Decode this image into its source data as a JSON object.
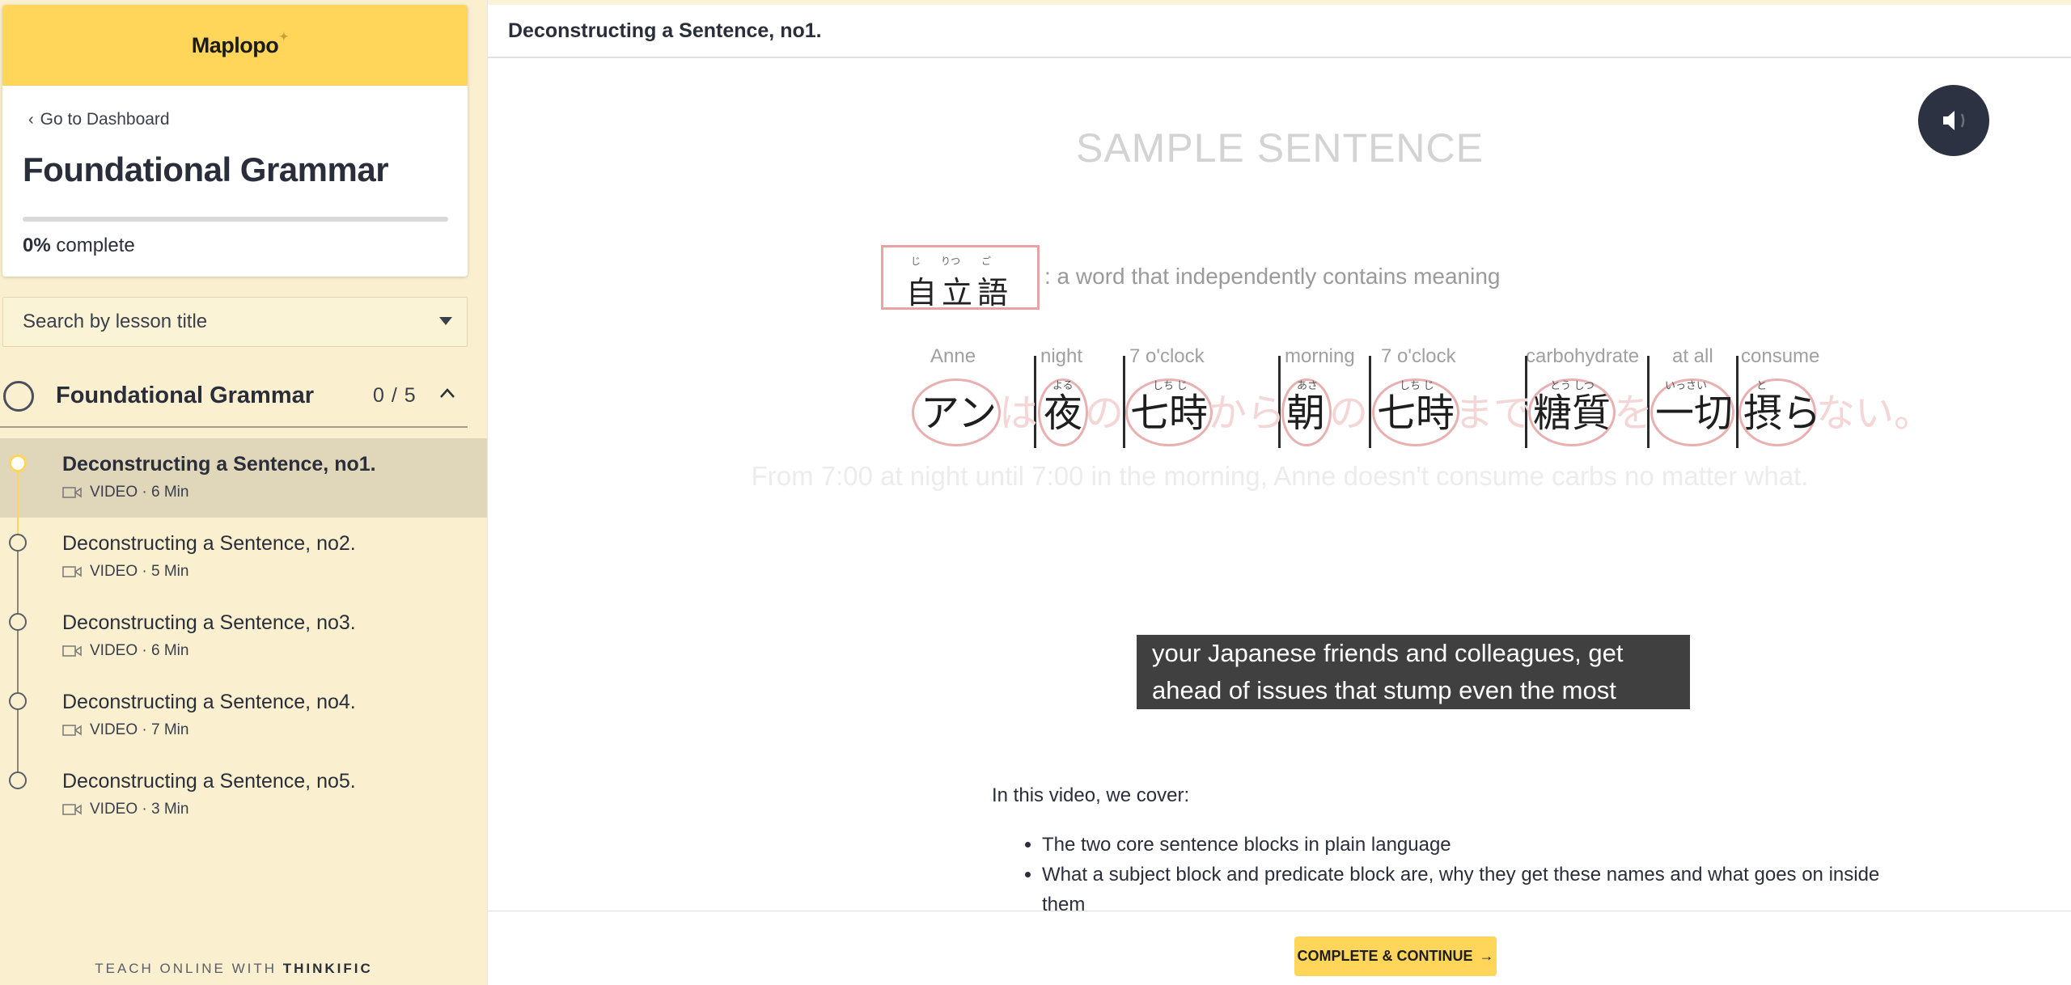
{
  "sidebar": {
    "logo": "Maplopo",
    "dashboard_link": "Go to Dashboard",
    "course_title": "Foundational Grammar",
    "progress_percent": 0,
    "progress_value": "0%",
    "progress_suffix": " complete",
    "search_placeholder": "Search by lesson title",
    "chapter": {
      "title": "Foundational Grammar",
      "count": "0 / 5"
    },
    "lessons": [
      {
        "title": "Deconstructing a Sentence, no1.",
        "meta": "VIDEO · 6 Min"
      },
      {
        "title": "Deconstructing a Sentence, no2.",
        "meta": "VIDEO · 5 Min"
      },
      {
        "title": "Deconstructing a Sentence, no3.",
        "meta": "VIDEO · 6 Min"
      },
      {
        "title": "Deconstructing a Sentence, no4.",
        "meta": "VIDEO · 7 Min"
      },
      {
        "title": "Deconstructing a Sentence, no5.",
        "meta": "VIDEO · 3 Min"
      }
    ],
    "footer_prefix": "TEACH ONLINE WITH ",
    "footer_brand": "THINKIFIC"
  },
  "main": {
    "lesson_title": "Deconstructing a Sentence, no1.",
    "video": {
      "sample_title": "SAMPLE SENTENCE",
      "term": {
        "kanji": [
          "自",
          "立",
          "語"
        ],
        "furigana": [
          "じ",
          "りつ",
          "ご"
        ],
        "definition": ": a word that independently contains meaning"
      },
      "glosses": [
        "Anne",
        "night",
        "7 o'clock",
        "morning",
        "7 o'clock",
        "carbohydrate",
        "at all",
        "consume"
      ],
      "words": [
        "アン",
        "夜",
        "七時",
        "朝",
        "七時",
        "糖質",
        "一切",
        "摂ら"
      ],
      "furigana": [
        "",
        "よる",
        "しち じ",
        "あさ",
        "しち じ",
        "とう しつ",
        "いっさい",
        "と"
      ],
      "particles": [
        "は",
        "の",
        "から",
        "の",
        "まで",
        "を",
        "ない。"
      ],
      "translation": "From 7:00 at night until 7:00 in the morning, Anne doesn't consume carbs no matter what.",
      "caption_line1": "your Japanese friends and colleagues, get",
      "caption_line2": "ahead of issues that stump even the most"
    },
    "content": {
      "intro": "In this video, we cover:",
      "bullets": [
        "The two core sentence blocks in plain language",
        "What a subject block and predicate block are, why they get these names and what goes on inside them"
      ]
    },
    "complete_button": "COMPLETE & CONTINUE",
    "complete_arrow": "→"
  },
  "colors": {
    "accent": "#ffd659",
    "sidebar_bg": "#faf0cf",
    "active_row": "#e0d6b9",
    "dark": "#2d3242"
  }
}
